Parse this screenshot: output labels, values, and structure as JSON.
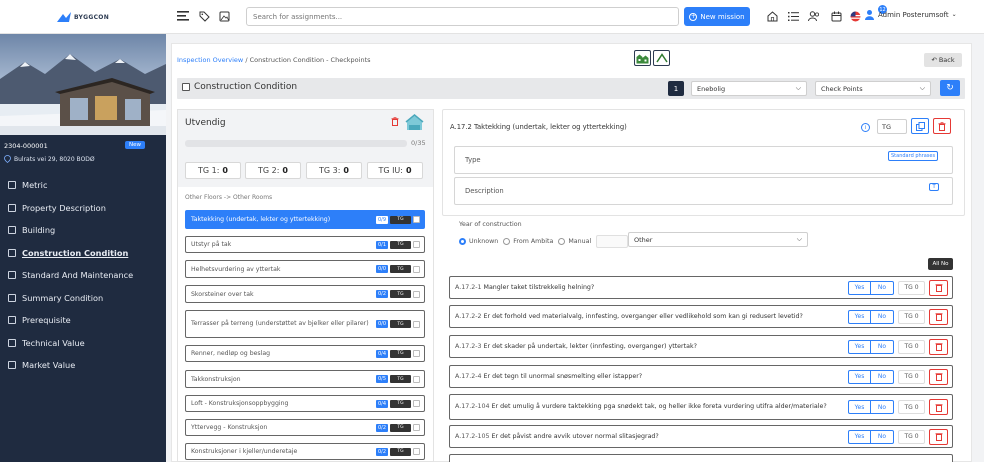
{
  "brand": {
    "logo_text": "BYGGCON"
  },
  "header": {
    "search_placeholder": "Search for assignments...",
    "new_mission_label": "New mission",
    "notification_count": "12",
    "user_name": "Admin Posterumsoft"
  },
  "sidebar": {
    "property_id": "2304-000001",
    "new_badge": "New",
    "address": "Bulrats vei 29, 8020 BODØ",
    "items": [
      {
        "label": "Metric"
      },
      {
        "label": "Property Description"
      },
      {
        "label": "Building"
      },
      {
        "label": "Construction Condition"
      },
      {
        "label": "Standard And Maintenance"
      },
      {
        "label": "Summary Condition"
      },
      {
        "label": "Prerequisite"
      },
      {
        "label": "Technical Value"
      },
      {
        "label": "Market Value"
      }
    ]
  },
  "breadcrumb": {
    "root": "Inspection Overview",
    "separator": "/",
    "current": "Construction Condition - Checkpoints"
  },
  "back_label": "Back",
  "section_bar": {
    "title": "Construction Condition",
    "number": "1",
    "building_type": "Enebolig",
    "view_select": "Check Points"
  },
  "left": {
    "title": "Utvendig",
    "progress_text": "0/35",
    "progress_fraction": 0.0,
    "tg": [
      {
        "label": "TG 1:",
        "value": "0"
      },
      {
        "label": "TG 2:",
        "value": "0"
      },
      {
        "label": "TG 3:",
        "value": "0"
      },
      {
        "label": "TG IU:",
        "value": "0"
      }
    ],
    "rooms_label": "Other Floors -> Other Rooms",
    "items": [
      {
        "label": "Taktekking (undertak, lekter og yttertekking)",
        "count": "0/9",
        "tg": "TG"
      },
      {
        "label": "Utstyr på tak",
        "count": "0/1",
        "tg": "TG"
      },
      {
        "label": "Helhetsvurdering av yttertak",
        "count": "0/0",
        "tg": "TG"
      },
      {
        "label": "Skorsteiner over tak",
        "count": "0/2",
        "tg": "TG"
      },
      {
        "label": "Terrasser på terreng (understøttet av bjelker eller pilarer)",
        "count": "0/0",
        "tg": "TG"
      },
      {
        "label": "Renner, nedløp og beslag",
        "count": "0/4",
        "tg": "TG"
      },
      {
        "label": "Takkonstruksjon",
        "count": "0/5",
        "tg": "TG"
      },
      {
        "label": "Loft - Konstruksjonsoppbygging",
        "count": "0/4",
        "tg": "TG"
      },
      {
        "label": "Yttervegg - Konstruksjon",
        "count": "0/2",
        "tg": "TG"
      },
      {
        "label": "Konstruksjoner i kjeller/underetaje",
        "count": "0/2",
        "tg": "TG"
      }
    ]
  },
  "detail": {
    "title": "A.17.2  Taktekking (undertak, lekter og yttertekking)",
    "tg_value": "TG",
    "type_label": "Type",
    "standard_phrases": "Standard phrases",
    "description_label": "Description",
    "t_icon_label": "T",
    "yoc_label": "Year of construction",
    "yoc_options": [
      "Unknown",
      "From Ambita",
      "Manual"
    ],
    "yoc_selected": "Unknown",
    "other_select": "Other",
    "all_no": "All No",
    "yes": "Yes",
    "no": "No",
    "questions": [
      {
        "code": "A.17.2-1",
        "text": "Mangler taket tilstrekkelig helning?",
        "tg": "TG 0"
      },
      {
        "code": "A.17.2-2",
        "text": "Er det forhold ved materialvalg, innfesting, overganger eller vedlikehold som kan gi redusert levetid?",
        "tg": "TG 0"
      },
      {
        "code": "A.17.2-3",
        "text": "Er det skader på undertak, lekter (innfesting, overganger) yttertak?",
        "tg": "TG 0"
      },
      {
        "code": "A.17.2-4",
        "text": "Er det tegn til unormal snøsmelting eller istapper?",
        "tg": "TG 0"
      },
      {
        "code": "A.17.2-104",
        "text": "Er det umulig å vurdere taktekking pga snødekt tak, og heller ikke foreta vurdering utifra alder/materiale?",
        "tg": "TG 0"
      },
      {
        "code": "A.17.2-105",
        "text": "Er det påvist andre avvik utover normal slitasjegrad?",
        "tg": "TG 0"
      }
    ]
  }
}
